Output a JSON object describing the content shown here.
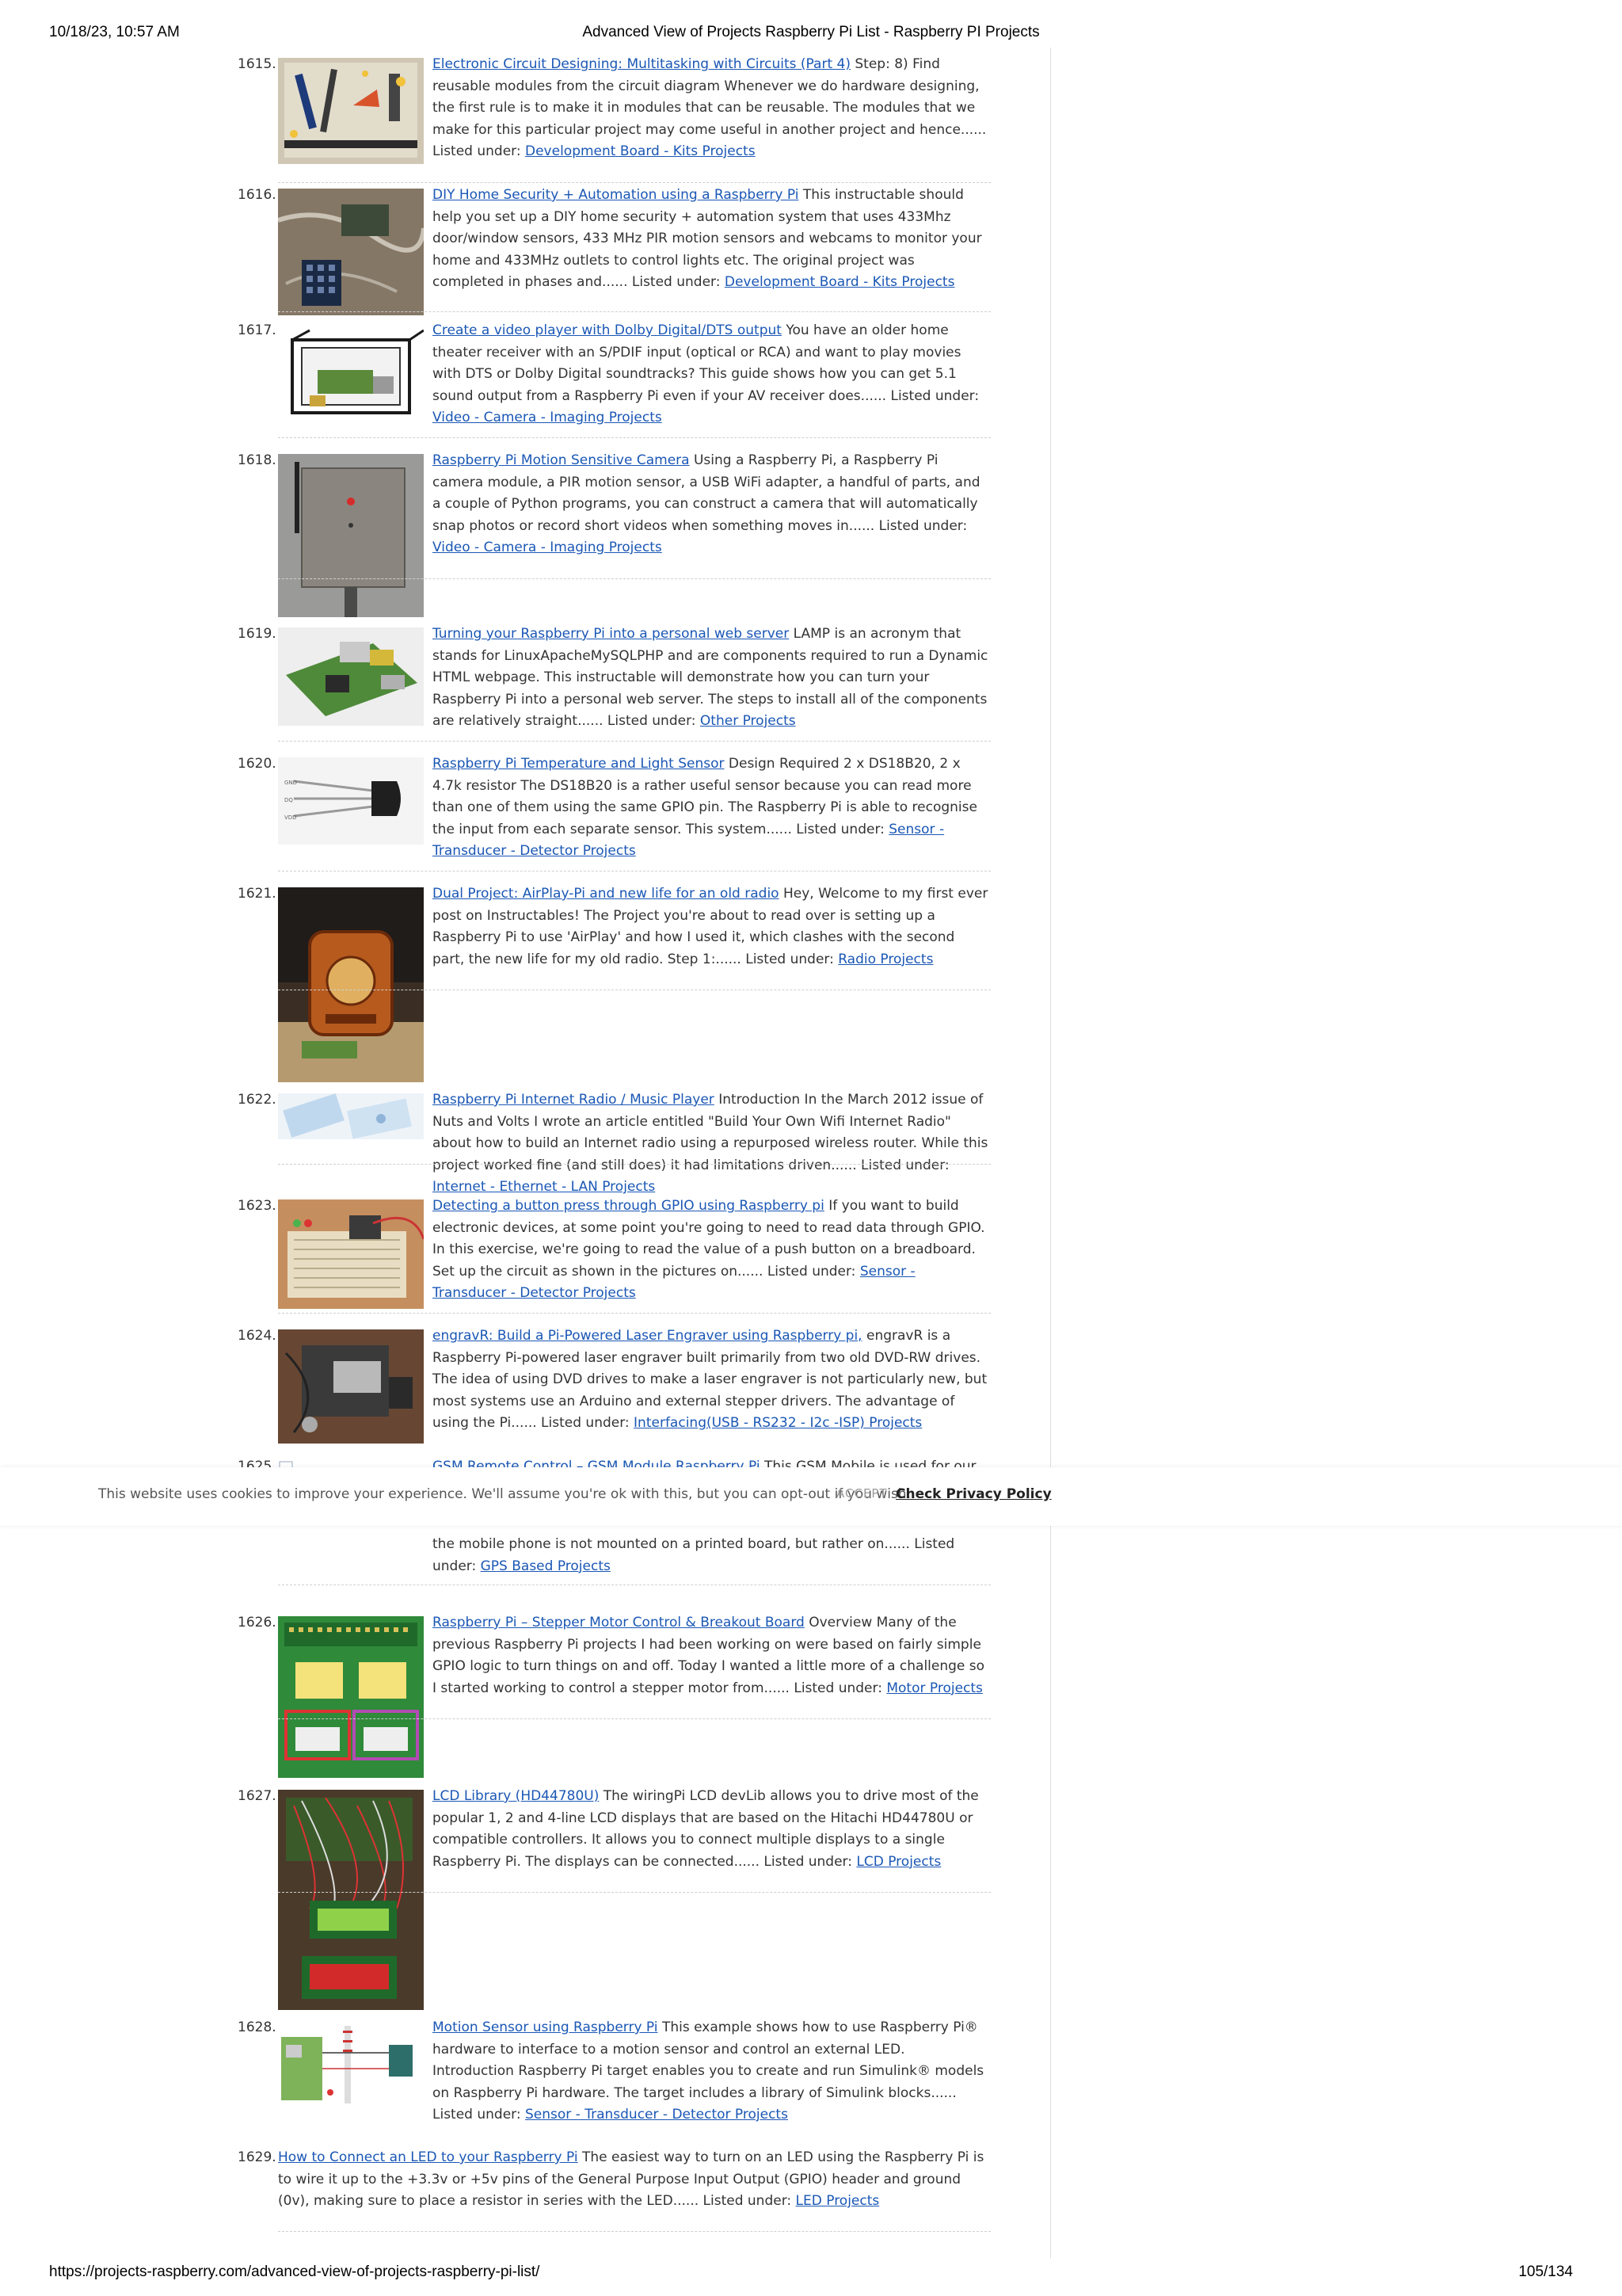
{
  "print_header": {
    "datetime": "10/18/23, 10:57 AM",
    "title": "Advanced View of Projects Raspberry Pi List - Raspberry PI Projects"
  },
  "print_footer": {
    "url": "https://projects-raspberry.com/advanced-view-of-projects-raspberry-pi-list/",
    "page": "105/134"
  },
  "entries": [
    {
      "num": "1615.",
      "link": "Electronic Circuit Designing: Multitasking with Circuits (Part 4)",
      "text": " Step: 8) Find reusable modules from the circuit diagram   Whenever we do hardware designing, the first rule is to make it in modules that can be reusable. The modules that we make for this particular project may come useful in another project and hence...... Listed under: ",
      "category": "Development Board - Kits Projects"
    },
    {
      "num": "1616.",
      "link": "DIY Home Security + Automation using a Raspberry Pi",
      "text": " This instructable should help you set up a DIY home security + automation system that uses 433Mhz door/window sensors, 433 MHz PIR motion sensors and webcams to monitor your home and 433MHz outlets to control lights etc. The original project was completed in phases and...... Listed under: ",
      "category": "Development Board - Kits Projects"
    },
    {
      "num": "1617.",
      "link": "Create a video player with Dolby Digital/DTS output",
      "text": " You have an older home theater receiver with an S/PDIF input (optical or RCA) and want to play movies with DTS or Dolby Digital soundtracks? This guide shows how you can get 5.1 sound output from a Raspberry Pi even if your AV receiver does...... Listed under: ",
      "category": "Video - Camera - Imaging Projects"
    },
    {
      "num": "1618.",
      "link": "Raspberry Pi Motion Sensitive Camera",
      "text": " Using a Raspberry Pi, a Raspberry Pi camera module, a PIR motion sensor, a USB WiFi adapter, a handful of parts, and a couple of Python programs, you can construct a camera that will automatically snap photos or record short videos when something moves in...... Listed under: ",
      "category": "Video - Camera - Imaging Projects"
    },
    {
      "num": "1619.",
      "link": "Turning your Raspberry Pi into a personal web server",
      "text": " LAMP is an acronym that stands for LinuxApacheMySQLPHP and are components required to run a Dynamic HTML webpage. This instructable will demonstrate how you can turn your Raspberry Pi into a personal web server. The steps to install all of the components are relatively straight...... Listed under: ",
      "category": "Other Projects"
    },
    {
      "num": "1620.",
      "link": "Raspberry Pi Temperature and Light Sensor",
      "text": " Design Required 2 x DS18B20, 2 x 4.7k resistor The DS18B20 is a rather useful sensor because you can read more than one of them using the same GPIO pin. The Raspberry Pi is able to recognise the input from each separate sensor. This system...... Listed under: ",
      "category": "Sensor - Transducer - Detector Projects"
    },
    {
      "num": "1621.",
      "link": "Dual Project: AirPlay-Pi and new life for an old radio",
      "text": " Hey, Welcome to my first ever post on Instructables! The Project you're about to read over is setting up a Raspberry Pi to use 'AirPlay' and how I used it, which clashes with the second part, the new life for my old radio. Step 1:...... Listed under: ",
      "category": "Radio Projects"
    },
    {
      "num": "1622.",
      "link": "Raspberry Pi Internet Radio / Music Player",
      "text": " Introduction In the March 2012 issue of Nuts and Volts I wrote an article entitled \"Build Your Own Wifi Internet Radio\" about how to build an Internet radio using a repurposed wireless router. While this project worked fine (and still does) it had limitations driven...... Listed under: ",
      "category": "Internet - Ethernet - LAN Projects"
    },
    {
      "num": "1623.",
      "link": "Detecting a button press through GPIO using Raspberry pi",
      "text": " If you want to build electronic devices, at some point you're going to need to read data through GPIO. In this exercise, we're going to read the value of a push button on a breadboard. Set up the circuit as shown in the pictures on...... Listed under: ",
      "category": "Sensor - Transducer - Detector Projects"
    },
    {
      "num": "1624.",
      "link": "engravR: Build a Pi-Powered Laser Engraver using Raspberry pi,",
      "text": " engravR is a Raspberry Pi-powered laser engraver built primarily from two old DVD-RW drives. The idea of using DVD drives to make a laser engraver is not particularly new, but most systems use an Arduino and external stepper drivers. The advantage of using the Pi...... Listed under: ",
      "category": "Interfacing(USB - RS232 - I2c -ISP) Projects"
    },
    {
      "num": "1625.",
      "link": "GSM Remote Control – GSM Module Raspberry Pi",
      "text": " This GSM Mobile is used for our",
      "text_after": "the mobile phone is not mounted on a printed board, but rather on...... Listed under: ",
      "category": "GPS Based Projects"
    },
    {
      "num": "1626.",
      "link": "Raspberry Pi – Stepper Motor Control & Breakout Board",
      "text": " Overview Many of the previous Raspberry Pi projects I had been working on were based on fairly simple GPIO logic to turn things on and off.  Today I wanted a little more of a challenge so I started working to control a stepper motor from...... Listed under: ",
      "category": "Motor Projects"
    },
    {
      "num": "1627.",
      "link": "LCD Library (HD44780U)",
      "text": " The wiringPi LCD devLib allows you to drive most of the popular 1, 2 and 4-line LCD displays that are based on the  Hitachi HD44780U or compatible controllers. It allows you to connect multiple displays to a single Raspberry Pi. The displays can be connected...... Listed under: ",
      "category": "LCD Projects"
    },
    {
      "num": "1628.",
      "link": "Motion Sensor using Raspberry Pi",
      "text": " This example shows how to use Raspberry Pi® hardware to interface to a motion sensor and control an external LED.   Introduction Raspberry Pi target enables you to create and run Simulink® models on Raspberry Pi hardware. The target includes a library of Simulink blocks...... Listed under: ",
      "category": "Sensor - Transducer - Detector Projects"
    },
    {
      "num": "1629.",
      "link": "How to Connect an LED to your Raspberry Pi",
      "text": " The easiest way to turn on an LED using the Raspberry Pi is to wire it up to the +3.3v or +5v pins of the General Purpose Input Output (GPIO) header and ground (0v), making sure to place a resistor in series with the LED...... Listed under: ",
      "category": "LED Projects"
    }
  ],
  "cookie_bar": {
    "message": "This website uses cookies to improve your experience. We'll assume you're ok with this, but you can opt-out if you wish.",
    "accept": "ACCEPT",
    "policy": "Check Privacy Policy"
  }
}
